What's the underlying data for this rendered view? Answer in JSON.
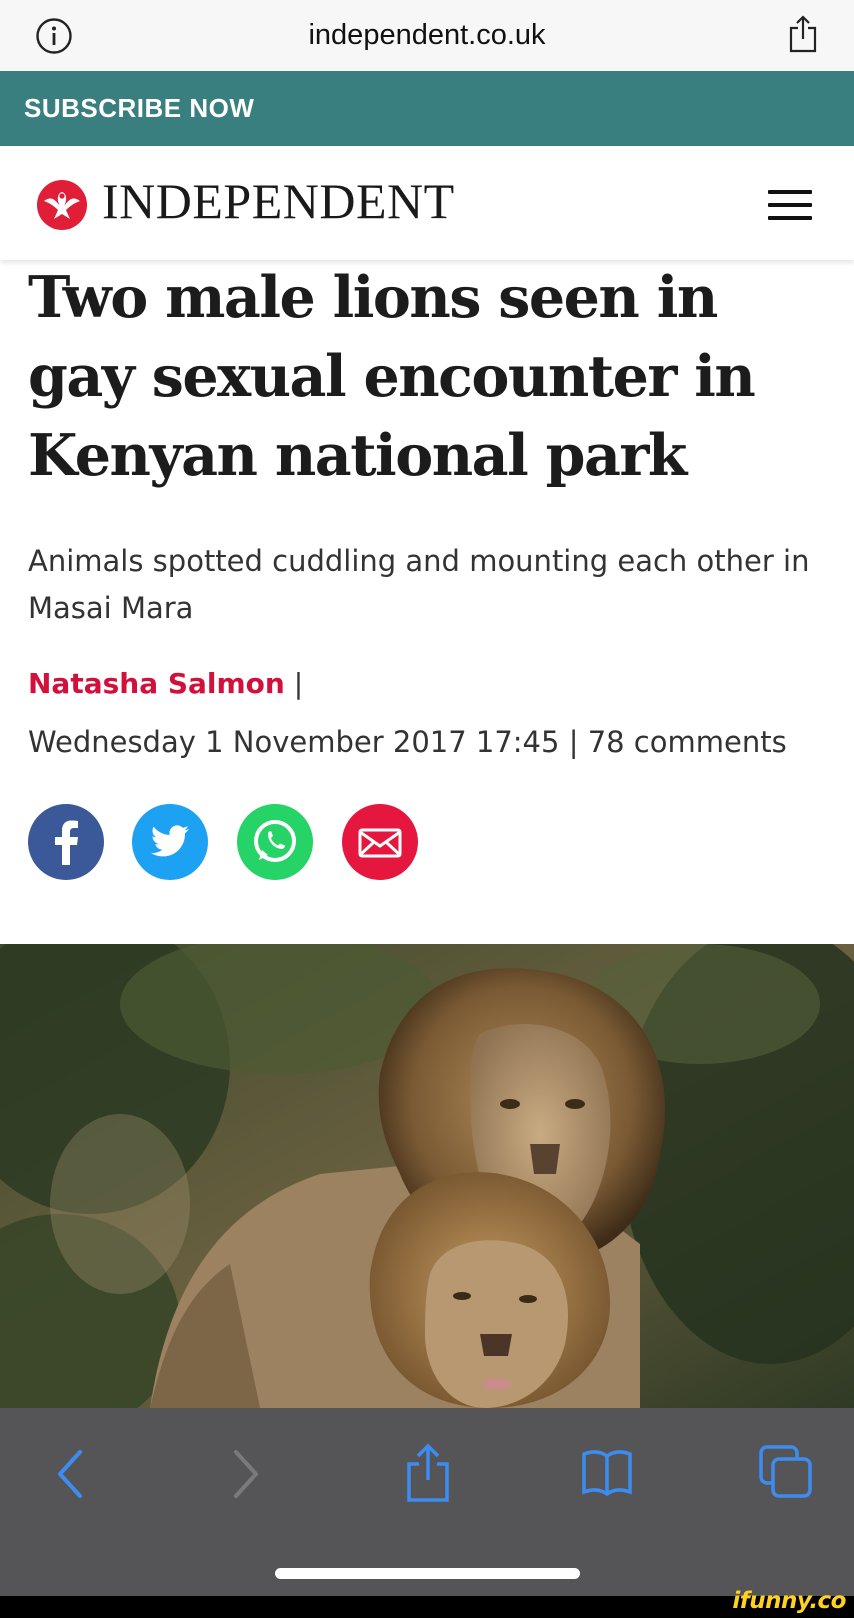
{
  "browser": {
    "url": "independent.co.uk",
    "icons": {
      "info": "info-circle-icon",
      "share": "share-icon"
    }
  },
  "banner": {
    "label": "SUBSCRIBE NOW",
    "color": "#3a7f80"
  },
  "masthead": {
    "brand": "INDEPENDENT",
    "icons": {
      "logo": "eagle-logo-icon",
      "menu": "hamburger-menu-icon"
    }
  },
  "article": {
    "headline": "Two male lions seen in gay sexual encounter in Kenyan national park",
    "standfirst": "Animals spotted cuddling and mounting each other in Masai Mara",
    "author": "Natasha Salmon",
    "author_separator": "|",
    "date": "Wednesday 1 November 2017 17:45",
    "comments_separator": "|",
    "comments": "78 comments",
    "author_color": "#d2103c"
  },
  "share_buttons": [
    {
      "icon": "facebook-icon",
      "color": "#3b5998"
    },
    {
      "icon": "twitter-icon",
      "color": "#1da1f2"
    },
    {
      "icon": "whatsapp-icon",
      "color": "#25d366"
    },
    {
      "icon": "email-icon",
      "color": "#e5173f"
    }
  ],
  "toolbar": {
    "icons": [
      "back-icon",
      "forward-icon",
      "share-icon",
      "bookmarks-icon",
      "tabs-icon"
    ],
    "accent": "#3d8cf0"
  },
  "watermark": "ifunny.co"
}
